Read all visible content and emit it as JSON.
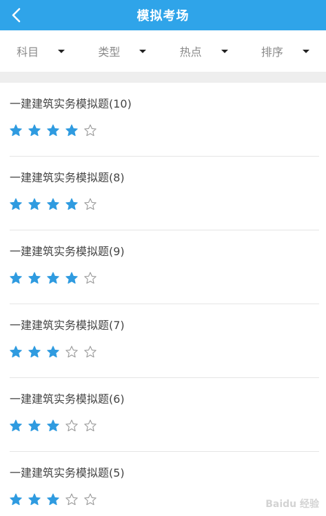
{
  "header": {
    "title": "模拟考场"
  },
  "filters": [
    {
      "label": "科目"
    },
    {
      "label": "类型"
    },
    {
      "label": "热点"
    },
    {
      "label": "排序"
    }
  ],
  "items": [
    {
      "title": "一建建筑实务模拟题(10)",
      "rating": 4,
      "max_rating": 5
    },
    {
      "title": "一建建筑实务模拟题(8)",
      "rating": 4,
      "max_rating": 5
    },
    {
      "title": "一建建筑实务模拟题(9)",
      "rating": 4,
      "max_rating": 5
    },
    {
      "title": "一建建筑实务模拟题(7)",
      "rating": 3,
      "max_rating": 5
    },
    {
      "title": "一建建筑实务模拟题(6)",
      "rating": 3,
      "max_rating": 5
    },
    {
      "title": "一建建筑实务模拟题(5)",
      "rating": 3,
      "max_rating": 5
    }
  ],
  "watermark": "Baidu 经验",
  "colors": {
    "accent": "#2fa4e9",
    "star_filled": "#2f9be0",
    "star_empty_stroke": "#9a9a9a"
  },
  "icons": {
    "back": "chevron-left-icon",
    "dropdown": "caret-down-icon",
    "star": "star-icon"
  }
}
